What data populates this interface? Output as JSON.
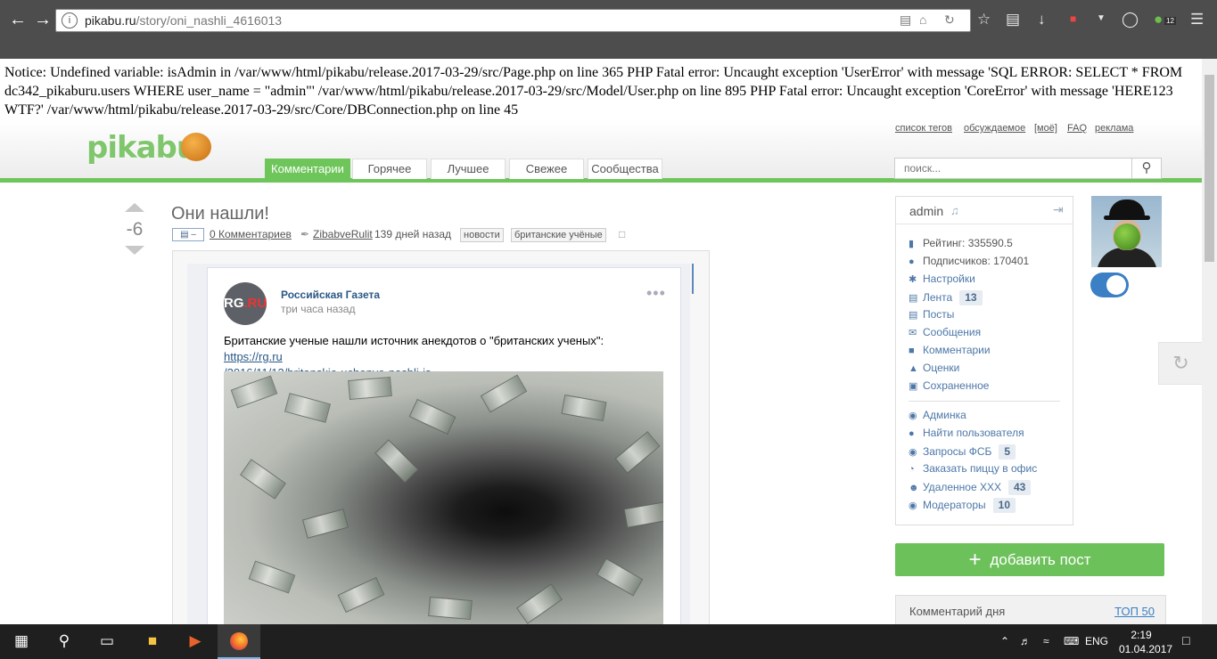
{
  "browser": {
    "url_domain": "pikabu.ru",
    "url_path": "/story/oni_nashli_4616013",
    "badge_count": "12"
  },
  "error_text": "Notice: Undefined variable: isAdmin in /var/www/html/pikabu/release.2017-03-29/src/Page.php on line 365 PHP Fatal error: Uncaught exception 'UserError' with message 'SQL ERROR: SELECT * FROM dc342_pikaburu.users WHERE user_name = \"admin\"' /var/www/html/pikabu/release.2017-03-29/src/Model/User.php on line 895 PHP Fatal error: Uncaught exception 'CoreError' with message 'HERE123 WTF?' /var/www/html/pikabu/release.2017-03-29/src/Core/DBConnection.php on line 45",
  "header": {
    "logo": "pikabu",
    "top_links": [
      "список тегов",
      "обсуждаемое",
      "[моё]",
      "FAQ",
      "реклама"
    ],
    "tabs": [
      "Комментарии",
      "Горячее",
      "Лучшее",
      "Свежее",
      "Сообщества"
    ],
    "search_placeholder": "поиск..."
  },
  "story": {
    "rating": "-6",
    "title": "Они нашли!",
    "comments": "0 Комментариев",
    "author": "ZibabveRulit",
    "time": "139 дней назад",
    "tags": [
      "новости",
      "британские учёные"
    ]
  },
  "vk_post": {
    "avatar_text_a": "RG",
    "avatar_text_b": ".RU",
    "group": "Российская Газета",
    "time": "три часа назад",
    "dots": "•••",
    "text": "Британские ученые нашли источник анекдотов о \"британских ученых\": ",
    "link_a": "https://rg.ru",
    "link_b": "/2016/11/13/britanskie-uchenye-nashli-is.."
  },
  "user": {
    "name": "admin",
    "rating": "Рейтинг: 335590.5",
    "subscribers": "Подписчиков: 170401",
    "menu": [
      {
        "label": "Настройки"
      },
      {
        "label": "Лента",
        "badge": "13"
      },
      {
        "label": "Посты"
      },
      {
        "label": "Сообщения"
      },
      {
        "label": "Комментарии"
      },
      {
        "label": "Оценки"
      },
      {
        "label": "Сохраненное"
      }
    ],
    "admin_menu": [
      {
        "label": "Админка"
      },
      {
        "label": "Найти пользователя"
      },
      {
        "label": "Запросы ФСБ",
        "badge": "5"
      },
      {
        "label": "Заказать пиццу в офис"
      },
      {
        "label": "Удаленное XXX",
        "badge": "43"
      },
      {
        "label": "Модераторы",
        "badge": "10"
      }
    ]
  },
  "add_post": "добавить пост",
  "comment_of_day": {
    "title": "Комментарий дня",
    "link": "ТОП 50"
  },
  "taskbar": {
    "lang": "ENG",
    "time": "2:19",
    "date": "01.04.2017"
  }
}
